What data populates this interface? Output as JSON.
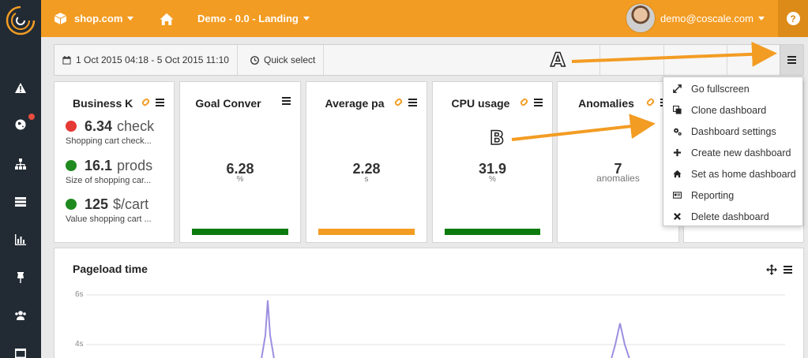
{
  "topbar": {
    "shop": "shop.com",
    "dashboard": "Demo - 0.0 - Landing",
    "user_email": "demo@coscale.com",
    "help": "?"
  },
  "toolbar": {
    "date_range": "1 Oct 2015 04:18 - 5 Oct 2015 11:10",
    "quick_select": "Quick select"
  },
  "widgets": {
    "business": {
      "title": "Business K",
      "items": [
        {
          "value": "6.34",
          "unit": "check",
          "sub": "Shopping cart check...",
          "color": "#e53935"
        },
        {
          "value": "16.1",
          "unit": "prods",
          "sub": "Size of shopping car...",
          "color": "#1f8a1f"
        },
        {
          "value": "125",
          "unit": "$/cart",
          "sub": "Value shopping cart ...",
          "color": "#1f8a1f"
        }
      ]
    },
    "goal": {
      "title": "Goal Conver",
      "value": "6.28",
      "unit": "%",
      "bar_color": "#0d7a0d"
    },
    "pageload": {
      "title": "Average pa",
      "value": "2.28",
      "unit": "s",
      "bar_color": "#f39c23"
    },
    "cpu": {
      "title": "CPU usage",
      "value": "31.9",
      "unit": "%",
      "bar_color": "#0d7a0d"
    },
    "anomalies": {
      "title": "Anomalies",
      "value": "7",
      "unit": "anomalies"
    }
  },
  "dropdown": {
    "items": [
      {
        "label": "Go fullscreen",
        "icon": "expand-icon"
      },
      {
        "label": "Clone dashboard",
        "icon": "clone-icon"
      },
      {
        "label": "Dashboard settings",
        "icon": "cogs-icon"
      },
      {
        "label": "Create new dashboard",
        "icon": "plus-icon"
      },
      {
        "label": "Set as home dashboard",
        "icon": "home-icon"
      },
      {
        "label": "Reporting",
        "icon": "report-icon"
      },
      {
        "label": "Delete dashboard",
        "icon": "close-icon"
      }
    ]
  },
  "chart": {
    "title": "Pageload time",
    "ticks": [
      "6s",
      "4s"
    ]
  },
  "annotations": {
    "a": "A",
    "b": "B"
  },
  "colors": {
    "brand": "#f39c23",
    "sidebar": "#222b34",
    "accent_line": "#9b8fe0"
  }
}
